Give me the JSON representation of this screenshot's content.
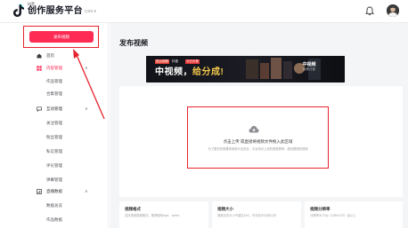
{
  "header": {
    "brand_small": "抖音",
    "brand_title": "创作服务平台",
    "brand_sub": "CSS ▾",
    "notification_icon": "bell-icon",
    "avatar_icon": "user-avatar"
  },
  "sidebar": {
    "publish_label": "发布视频",
    "items": [
      {
        "label": "首页",
        "icon": "home-icon"
      },
      {
        "label": "内容管理",
        "icon": "grid-icon",
        "active": true,
        "chevron": "∧"
      },
      {
        "label": "作品管理"
      },
      {
        "label": "合集管理"
      },
      {
        "label": "互动管理",
        "icon": "chat-icon",
        "chevron": "∧"
      },
      {
        "label": "关注管理"
      },
      {
        "label": "粉丝管理"
      },
      {
        "label": "私信管理"
      },
      {
        "label": "评论管理"
      },
      {
        "label": "弹幕管理"
      },
      {
        "label": "直播数据",
        "icon": "chart-icon",
        "chevron": "∧"
      },
      {
        "label": "数据总览"
      },
      {
        "label": "作品数据"
      }
    ]
  },
  "main": {
    "page_title": "发布视频",
    "banner": {
      "tags": [
        "西瓜视频",
        "抖音",
        "今日头条"
      ],
      "headline_a": "中视频，",
      "headline_b": "给分成!",
      "brand": "中视频",
      "brand_sub": "伙伴计划"
    },
    "upload": {
      "title": "点击上传 或直接将视频文件拖入此区域",
      "subtitle": "为了更好的观看体验和平台安全，平台将对上传的视频预审，超出限制的视频"
    },
    "info_cards": [
      {
        "title": "视频格式",
        "desc": "支持常用视频格式，推荐使用mp4、webm"
      },
      {
        "title": "视频大小",
        "desc": "视频文件大小不超过16G，时长在60分钟以内"
      },
      {
        "title": "视频分辨率",
        "desc": "分辨率为720p（1280x720）及以上"
      }
    ]
  },
  "colors": {
    "accent": "#fe2c55",
    "annotation_red": "#e6232c",
    "banner_bg": "#0f1015",
    "banner_accent": "#f2c84b"
  }
}
